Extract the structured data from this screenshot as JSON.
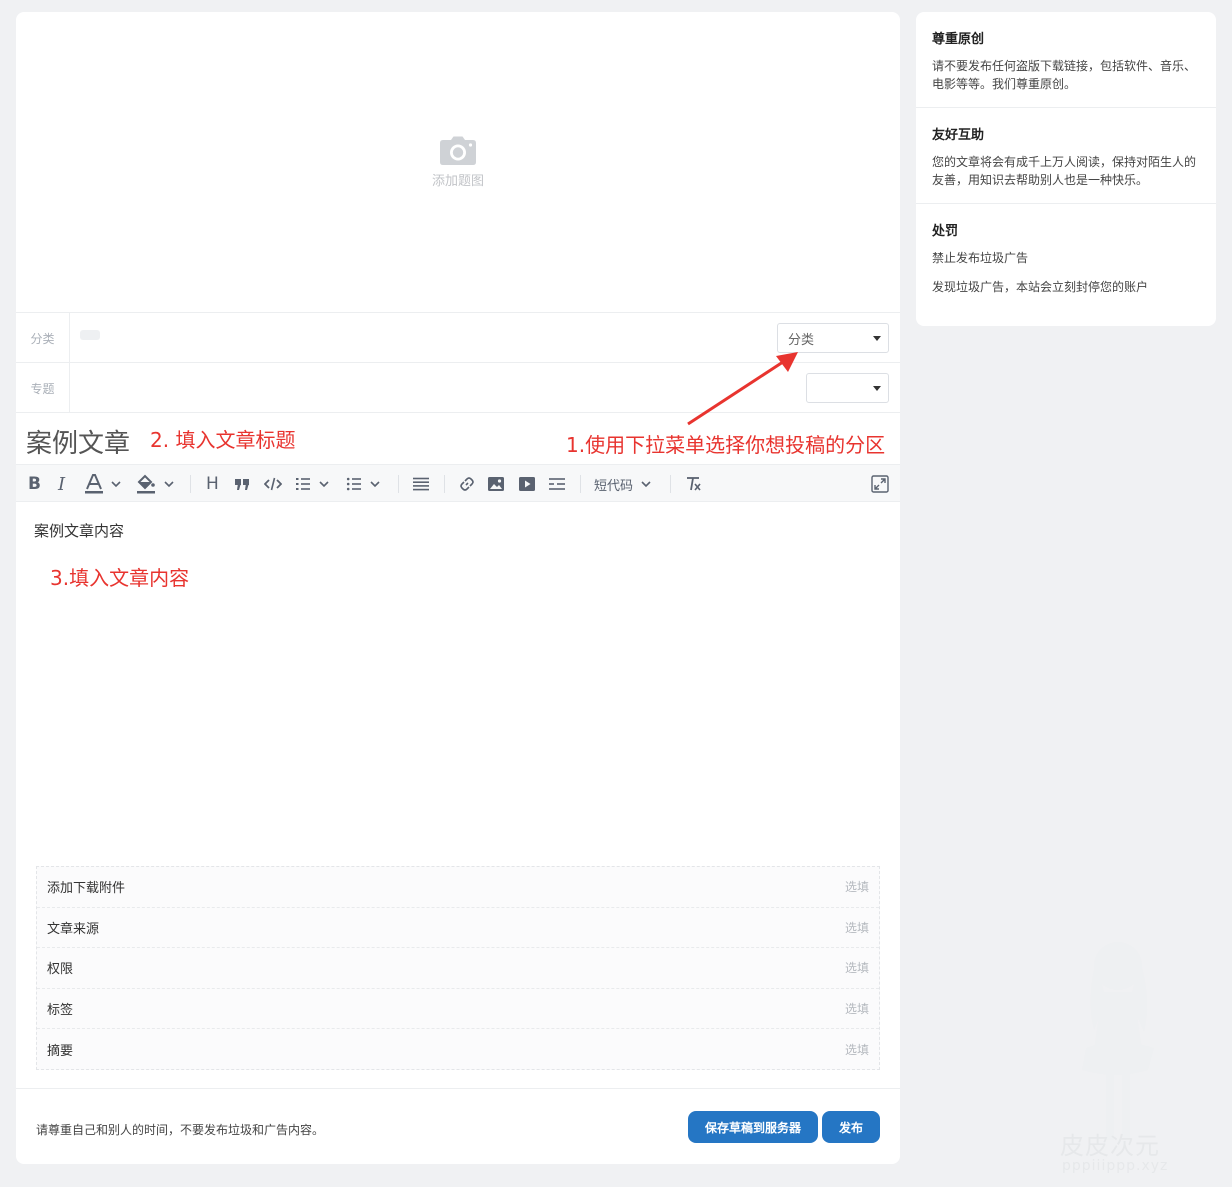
{
  "cover": {
    "label": "添加题图"
  },
  "fields": {
    "category": {
      "label": "分类",
      "select_value": "分类"
    },
    "topic": {
      "label": "专题",
      "select_value": ""
    }
  },
  "title": {
    "value": "案例文章"
  },
  "annotations": {
    "step1": "1.使用下拉菜单选择你想投稿的分区",
    "step2": "2. 填入文章标题",
    "step3": "3.填入文章内容",
    "color": "#e8342f"
  },
  "toolbar": {
    "bold": "B",
    "italic": "I",
    "heading": "H",
    "shortcode_label": "短代码"
  },
  "editor": {
    "content": "案例文章内容"
  },
  "extras": [
    {
      "label": "添加下载附件",
      "hint": "选填"
    },
    {
      "label": "文章来源",
      "hint": "选填"
    },
    {
      "label": "权限",
      "hint": "选填"
    },
    {
      "label": "标签",
      "hint": "选填"
    },
    {
      "label": "摘要",
      "hint": "选填"
    }
  ],
  "footer": {
    "note": "请尊重自己和别人的时间，不要发布垃圾和广告内容。",
    "save_draft_label": "保存草稿到服务器",
    "publish_label": "发布",
    "button_color": "#2576c4"
  },
  "sidebar": {
    "sections": [
      {
        "title": "尊重原创",
        "paragraphs": [
          "请不要发布任何盗版下载链接，包括软件、音乐、电影等等。我们尊重原创。"
        ]
      },
      {
        "title": "友好互助",
        "paragraphs": [
          "您的文章将会有成千上万人阅读，保持对陌生人的友善，用知识去帮助别人也是一种快乐。"
        ]
      },
      {
        "title": "处罚",
        "paragraphs": [
          "禁止发布垃圾广告",
          "发现垃圾广告，本站会立刻封停您的账户"
        ]
      }
    ]
  },
  "watermark": {
    "name": "皮皮次元",
    "domain": "pppiiippp.xyz"
  }
}
